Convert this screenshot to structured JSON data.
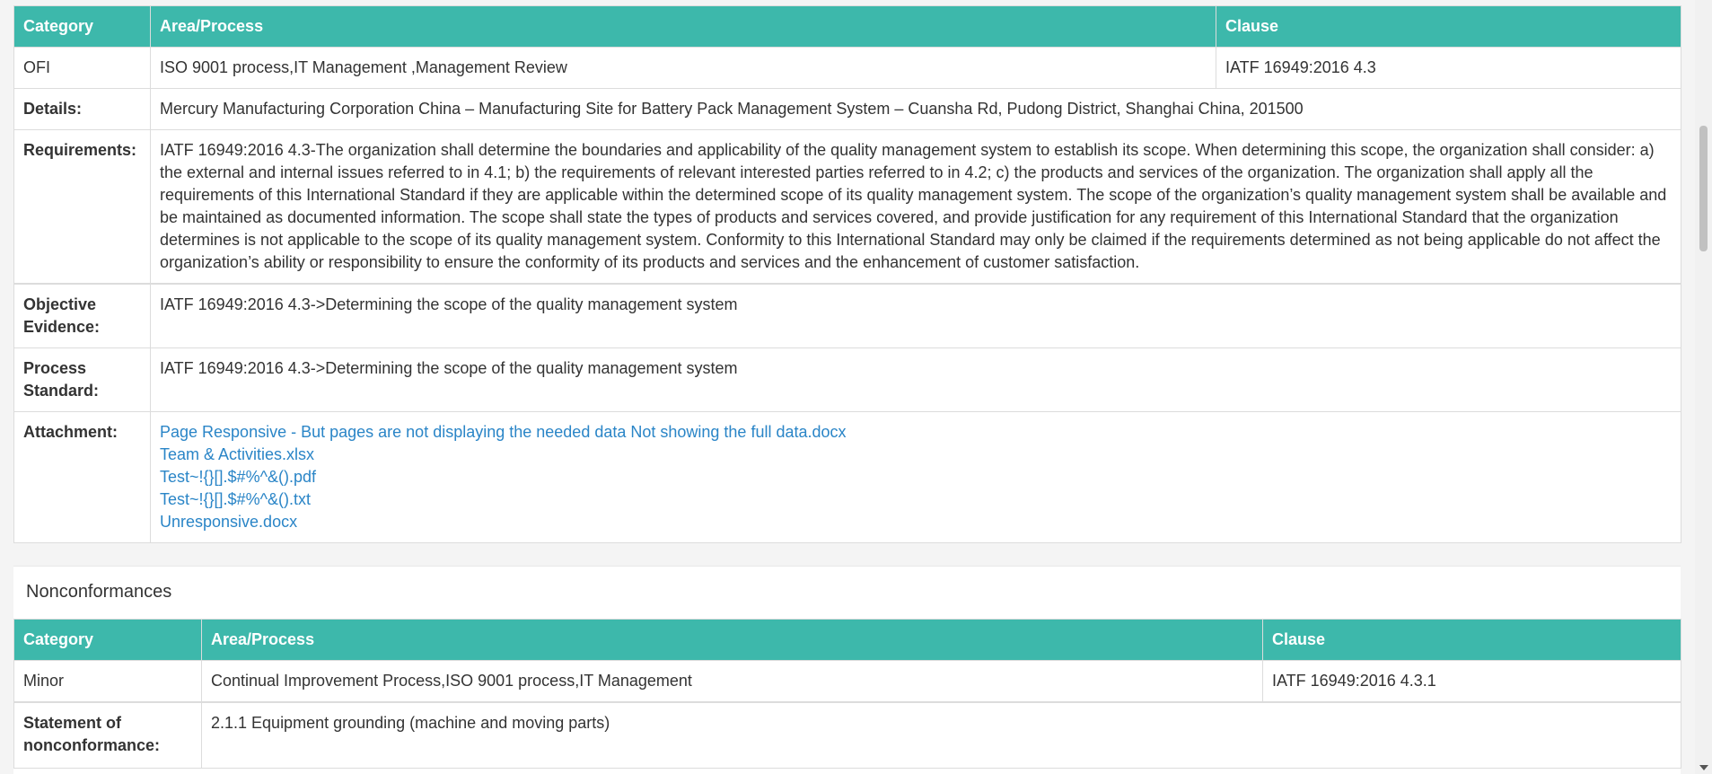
{
  "ofi_table": {
    "headers": {
      "category": "Category",
      "area": "Area/Process",
      "clause": "Clause"
    },
    "category": "OFI",
    "area": "ISO 9001 process,IT Management ,Management Review",
    "clause": "IATF 16949:2016 4.3",
    "details_label": "Details:",
    "details": "Mercury Manufacturing Corporation China – Manufacturing Site for Battery Pack Management System – Cuansha Rd, Pudong District, Shanghai China, 201500",
    "requirements_label": "Requirements:",
    "requirements": "IATF 16949:2016 4.3-The organization shall determine the boundaries and applicability of the quality management system to establish its scope. When determining this scope, the organization shall consider: a) the external and internal issues referred to in 4.1; b) the requirements of relevant interested parties referred to in 4.2; c) the products and services of the organization. The organization shall apply all the requirements of this International Standard if they are applicable within the determined scope of its quality management system. The scope of the organization’s quality management system shall be available and be maintained as documented information. The scope shall state the types of products and services covered, and provide justification for any requirement of this International Standard that the organization determines is not applicable to the scope of its quality management system. Conformity to this International Standard may only be claimed if the requirements determined as not being applicable do not affect the organization’s ability or responsibility to ensure the conformity of its products and services and the enhancement of customer satisfaction.",
    "objective_label": "Objective Evidence:",
    "objective": "IATF 16949:2016 4.3->Determining the scope of the quality management system",
    "process_label": "Process Standard:",
    "process": "IATF 16949:2016 4.3->Determining the scope of the quality management system",
    "attachment_label": "Attachment:",
    "attachments": [
      "Page Responsive - But pages are not displaying the needed data Not showing the full data.docx",
      "Team & Activities.xlsx",
      "Test~!{}[].$#%^&().pdf",
      "Test~!{}[].$#%^&().txt",
      "Unresponsive.docx"
    ]
  },
  "nonconformances": {
    "title": "Nonconformances",
    "headers": {
      "category": "Category",
      "area": "Area/Process",
      "clause": "Clause"
    },
    "category": "Minor",
    "area": "Continual Improvement Process,ISO 9001 process,IT Management",
    "clause": "IATF 16949:2016 4.3.1",
    "statement_label": "Statement of nonconformance:",
    "statement": "2.1.1 Equipment grounding (machine and moving parts)"
  },
  "colors": {
    "header_bg": "#3db8ab",
    "link": "#2a85c7"
  }
}
